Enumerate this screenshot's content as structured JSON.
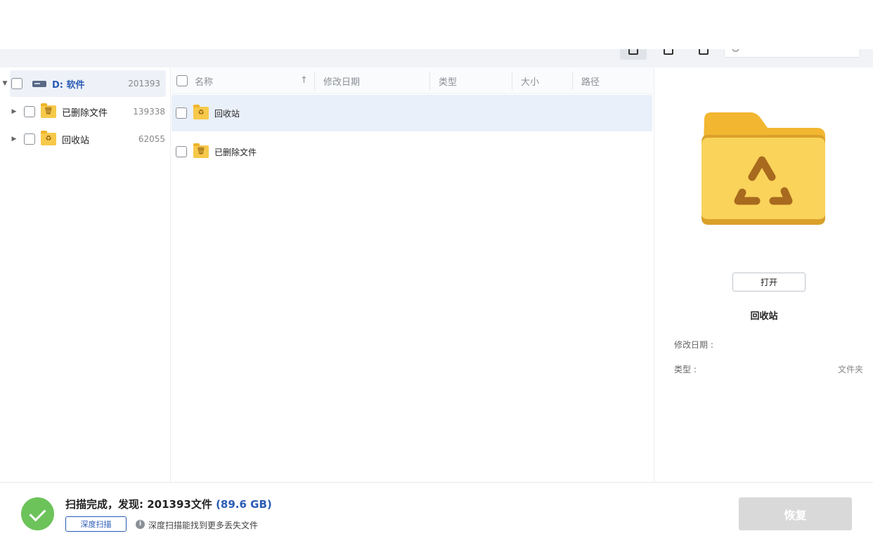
{
  "tree": {
    "items": [
      {
        "label": "D: 软件",
        "count": "201393"
      },
      {
        "label": "已删除文件",
        "count": "139338"
      },
      {
        "label": "回收站",
        "count": "62055"
      }
    ]
  },
  "list": {
    "columns": {
      "name": "名称",
      "modified": "修改日期",
      "type": "类型",
      "size": "大小",
      "path": "路径"
    },
    "rows": [
      {
        "name": "回收站"
      },
      {
        "name": "已删除文件"
      }
    ]
  },
  "detail": {
    "open_label": "打开",
    "name": "回收站",
    "modified_label": "修改日期 :",
    "type_label": "类型 :",
    "type_value": "文件夹"
  },
  "footer": {
    "status": "扫描完成，发现: 201393文件",
    "size": "(89.6 GB)",
    "deep_scan_label": "深度扫描",
    "hint": "深度扫描能找到更多丢失文件",
    "recover_label": "恢复"
  },
  "colors": {
    "accent": "#2a5bb5",
    "success": "#6cc35a",
    "folder": "#f7c94a",
    "selection": "#eaf0f9"
  }
}
